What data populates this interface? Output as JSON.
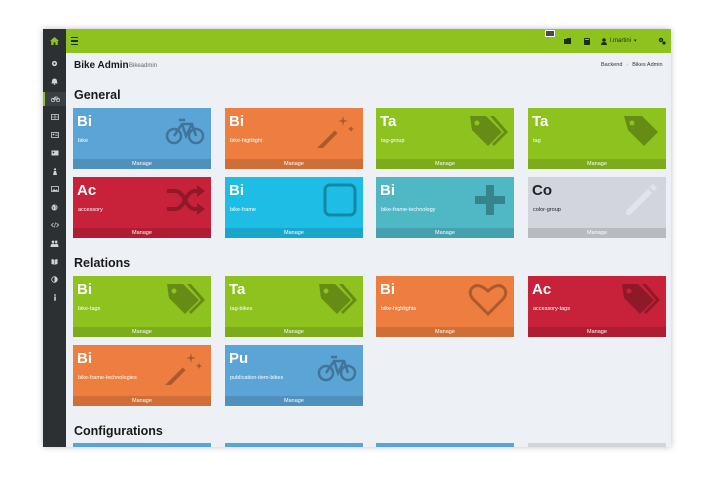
{
  "topbar": {
    "user_name": "l.martini",
    "icons": [
      "home-icon",
      "menu-icon",
      "folder-icon",
      "book-icon",
      "user-icon",
      "caret-down-icon",
      "gears-icon"
    ]
  },
  "sidebar": {
    "items": [
      "gear-icon",
      "bell-icon",
      "bike-icon",
      "grid-icon",
      "id-card-icon",
      "id-card-icon",
      "person-icon",
      "image-icon",
      "globe-icon",
      "code-icon",
      "users-icon",
      "book-icon",
      "contrast-icon",
      "info-icon"
    ]
  },
  "header": {
    "title": "Bike Admin",
    "subtitle": "Bikeadmin",
    "breadcrumb": [
      "Backend",
      "Bikes Admin"
    ]
  },
  "sections": {
    "general": {
      "title": "General",
      "tiles": [
        {
          "abbr": "Bi",
          "name": "bike",
          "icon": "bicycle-icon",
          "color": "#5aa4d6",
          "manage": "Manage"
        },
        {
          "abbr": "Bi",
          "name": "bike-highlight",
          "icon": "magic-wand-icon",
          "color": "#ed7e3f",
          "manage": "Manage"
        },
        {
          "abbr": "Ta",
          "name": "tag-group",
          "icon": "tags-icon",
          "color": "#8ec31f",
          "manage": "Manage"
        },
        {
          "abbr": "Ta",
          "name": "tag",
          "icon": "tag-icon",
          "color": "#8ec31f",
          "manage": "Manage"
        },
        {
          "abbr": "Ac",
          "name": "accessory",
          "icon": "shuffle-icon",
          "color": "#c8223a",
          "manage": "Manage"
        },
        {
          "abbr": "Bi",
          "name": "bike-frame",
          "icon": "square-icon",
          "color": "#1ebde6",
          "manage": "Manage"
        },
        {
          "abbr": "Bi",
          "name": "bike-frame-technology",
          "icon": "plus-icon",
          "color": "#4fb8c4",
          "manage": "Manage"
        },
        {
          "abbr": "Co",
          "name": "color-group",
          "icon": "pencil-icon",
          "color": "#d2d6dc",
          "manage": "Manage"
        }
      ]
    },
    "relations": {
      "title": "Relations",
      "tiles": [
        {
          "abbr": "Bi",
          "name": "bike-tags",
          "icon": "tags-icon",
          "color": "#8ec31f",
          "manage": "Manage"
        },
        {
          "abbr": "Ta",
          "name": "tag-bikes",
          "icon": "tags-icon",
          "color": "#8ec31f",
          "manage": "Manage"
        },
        {
          "abbr": "Bi",
          "name": "bike-highlights",
          "icon": "heart-icon",
          "color": "#ed7e3f",
          "manage": "Manage"
        },
        {
          "abbr": "Ac",
          "name": "accessory-tags",
          "icon": "tags-icon",
          "color": "#c8223a",
          "manage": "Manage"
        },
        {
          "abbr": "Bi",
          "name": "bike-frame-technologies",
          "icon": "magic-wand-icon",
          "color": "#ed7e3f",
          "manage": "Manage"
        },
        {
          "abbr": "Pu",
          "name": "publication-item-bikes",
          "icon": "bicycle-icon",
          "color": "#5aa4d6",
          "manage": "Manage"
        }
      ]
    },
    "configurations": {
      "title": "Configurations",
      "strip_colors": [
        "#5aa4d6",
        "#5aa4d6",
        "#5aa4d6",
        "#d2d6dc"
      ]
    }
  },
  "colors": {
    "accent": "#8ec31f",
    "sidebar_bg": "#2c3033",
    "content_bg": "#edf0f5"
  }
}
